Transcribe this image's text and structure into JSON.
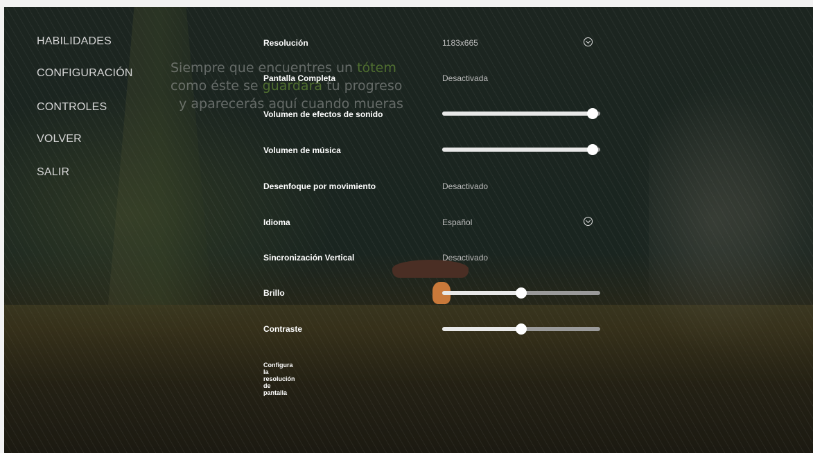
{
  "background_hint": {
    "line1_a": "Siempre que encuentres un ",
    "line1_b": "tótem",
    "line2_a": "como éste se ",
    "line2_b": "guardará",
    "line2_c": " tu progreso",
    "line3": "y aparecerás aquí cuando mueras"
  },
  "menu": {
    "items": [
      "HABILIDADES",
      "CONFIGURACIÓN",
      "CONTROLES",
      "VOLVER",
      "SALIR"
    ]
  },
  "settings": {
    "resolution": {
      "label": "Resolución",
      "value": "1183x665"
    },
    "fullscreen": {
      "label": "Pantalla Completa",
      "value": "Desactivada"
    },
    "sfx_volume": {
      "label": "Volumen de efectos de sonido",
      "level": 0.95
    },
    "music_volume": {
      "label": "Volumen de música",
      "level": 0.95
    },
    "motion_blur": {
      "label": "Desenfoque por movimiento",
      "value": "Desactivado"
    },
    "language": {
      "label": "Idioma",
      "value": "Español"
    },
    "vsync": {
      "label": "Sincronización Vertical",
      "value": "Desactivado"
    },
    "brightness": {
      "label": "Brillo",
      "level": 0.5
    },
    "contrast": {
      "label": "Contraste",
      "level": 0.5
    }
  },
  "description": "Configura la resolución de pantalla",
  "icons": {
    "dropdown": "chevron-down-circle-icon"
  },
  "colors": {
    "text": "#ffffff",
    "value_text": "#bdbdbd",
    "menu_text": "#d6d6d6",
    "slider_track": "#9a9a9a",
    "slider_fill": "#e8e8e8"
  }
}
